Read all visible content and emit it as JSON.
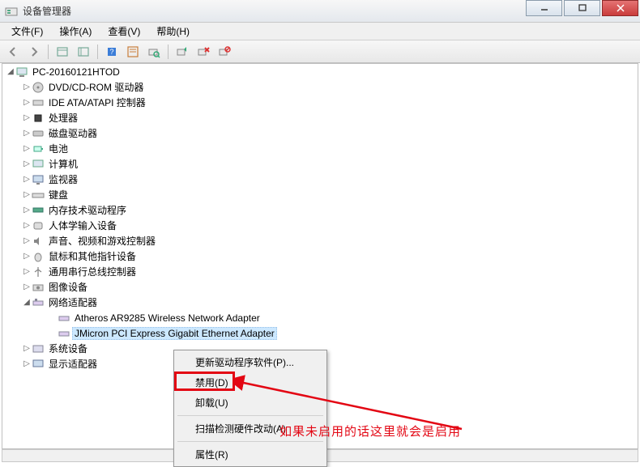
{
  "window": {
    "title": "设备管理器"
  },
  "menubar": {
    "file": "文件(F)",
    "action": "操作(A)",
    "view": "查看(V)",
    "help": "帮助(H)"
  },
  "tree": {
    "root": "PC-20160121HTOD",
    "items": [
      "DVD/CD-ROM 驱动器",
      "IDE ATA/ATAPI 控制器",
      "处理器",
      "磁盘驱动器",
      "电池",
      "计算机",
      "监视器",
      "键盘",
      "内存技术驱动程序",
      "人体学输入设备",
      "声音、视频和游戏控制器",
      "鼠标和其他指针设备",
      "通用串行总线控制器",
      "图像设备"
    ],
    "network": {
      "label": "网络适配器",
      "children": [
        "Atheros AR9285 Wireless Network Adapter",
        "JMicron PCI Express Gigabit Ethernet Adapter"
      ]
    },
    "after": [
      "系统设备",
      "显示适配器"
    ]
  },
  "context_menu": {
    "update": "更新驱动程序软件(P)...",
    "disable": "禁用(D)",
    "uninstall": "卸载(U)",
    "scan": "扫描检测硬件改动(A)",
    "properties": "属性(R)"
  },
  "annotation": "如果未启用的话这里就会是启用"
}
